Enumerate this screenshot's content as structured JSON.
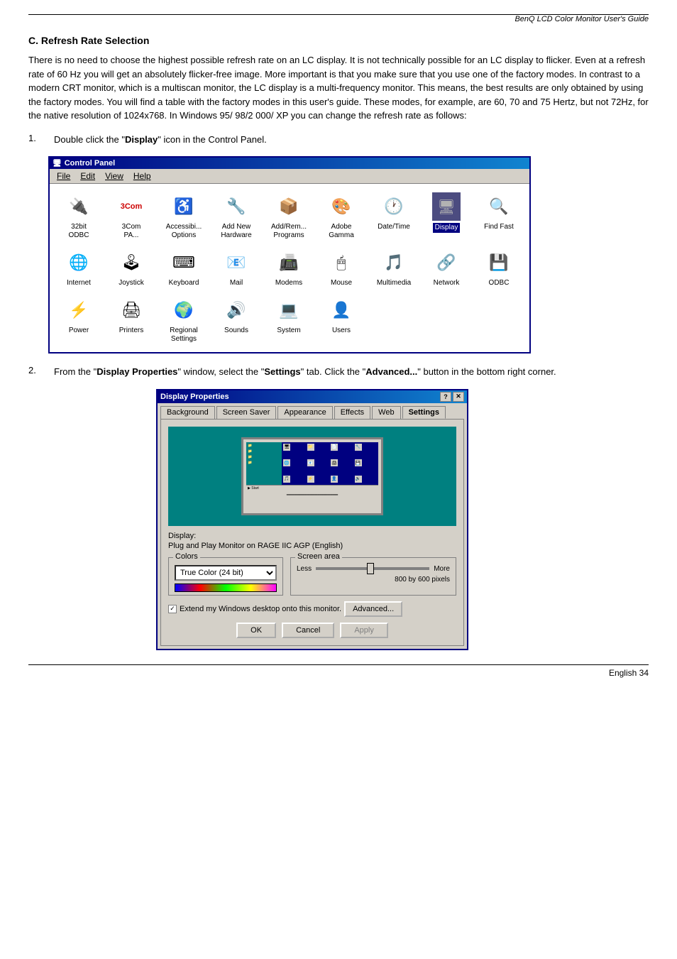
{
  "header": {
    "title": "BenQ LCD Color Monitor User's Guide"
  },
  "section": {
    "title": "C. Refresh Rate Selection",
    "body": "There is no need to choose the highest possible refresh rate on an LC display. It is not technically possible for an LC display to flicker. Even at a refresh rate of 60 Hz you will get an absolutely flicker-free image. More important is that you make sure that you use one of the factory modes.  In contrast to a modern CRT monitor, which is a multiscan monitor, the LC display is a multi-frequency monitor. This means, the best results are only obtained by using the factory modes. You will find a table with the factory modes in this user's guide. These modes, for example, are 60, 70 and 75 Hertz, but not 72Hz, for the native resolution of 1024x768. In Windows 95/ 98/2 000/ XP you can change the refresh rate as follows:"
  },
  "step1": {
    "number": "1.",
    "text_before": "Double click the \"",
    "bold": "Display",
    "text_after": "\" icon in the Control Panel."
  },
  "step2": {
    "number": "2.",
    "text_before": "From the \"",
    "bold1": "Display Properties",
    "text_mid1": "\" window, select the \"",
    "bold2": "Settings",
    "text_mid2": "\" tab. Click the \"",
    "bold3": "Advanced...",
    "text_after": "\" button in the bottom right corner."
  },
  "control_panel": {
    "title": "Control Panel",
    "menu_items": [
      "File",
      "Edit",
      "View",
      "Help"
    ],
    "icons": [
      {
        "label": "32bit\nODBC",
        "icon": "🔌",
        "id": "32bit-odbc"
      },
      {
        "label": "3Com\nPA...",
        "icon": "🖥",
        "id": "3com"
      },
      {
        "label": "Accessibi...\nOptions",
        "icon": "♿",
        "id": "accessibility"
      },
      {
        "label": "Add New\nHardware",
        "icon": "🔧",
        "id": "add-hardware"
      },
      {
        "label": "Add/Rem...\nPrograms",
        "icon": "📦",
        "id": "add-remove"
      },
      {
        "label": "Adobe\nGamma",
        "icon": "🎨",
        "id": "adobe-gamma"
      },
      {
        "label": "Date/Time",
        "icon": "🕐",
        "id": "date-time"
      },
      {
        "label": "Display",
        "icon": "🖥",
        "id": "display",
        "selected": true
      },
      {
        "label": "Find Fast",
        "icon": "🔍",
        "id": "find-fast"
      },
      {
        "label": "Internet",
        "icon": "🌐",
        "id": "internet"
      },
      {
        "label": "Joystick",
        "icon": "🕹",
        "id": "joystick"
      },
      {
        "label": "Keyboard",
        "icon": "⌨",
        "id": "keyboard"
      },
      {
        "label": "Mail",
        "icon": "📧",
        "id": "mail"
      },
      {
        "label": "Modems",
        "icon": "📠",
        "id": "modems"
      },
      {
        "label": "Mouse",
        "icon": "🖱",
        "id": "mouse"
      },
      {
        "label": "Multimedia",
        "icon": "🎵",
        "id": "multimedia"
      },
      {
        "label": "Network",
        "icon": "🔗",
        "id": "network"
      },
      {
        "label": "ODBC",
        "icon": "💾",
        "id": "odbc"
      },
      {
        "label": "Power",
        "icon": "⚡",
        "id": "power"
      },
      {
        "label": "Printers",
        "icon": "🖨",
        "id": "printers"
      },
      {
        "label": "Regional\nSettings",
        "icon": "🌍",
        "id": "regional"
      },
      {
        "label": "Sounds",
        "icon": "🔊",
        "id": "sounds"
      },
      {
        "label": "System",
        "icon": "💻",
        "id": "system"
      },
      {
        "label": "Users",
        "icon": "👤",
        "id": "users"
      }
    ]
  },
  "display_properties": {
    "title": "Display Properties",
    "tabs": [
      "Background",
      "Screen Saver",
      "Appearance",
      "Effects",
      "Web",
      "Settings"
    ],
    "active_tab": "Settings",
    "display_label": "Display:",
    "display_value": "Plug and Play Monitor on RAGE IIC AGP (English)",
    "colors_group": "Colors",
    "colors_value": "True Color (24 bit)",
    "screen_area_group": "Screen area",
    "less_label": "Less",
    "more_label": "More",
    "pixels_label": "800 by 600 pixels",
    "checkbox_label": "Extend my Windows desktop onto this monitor.",
    "advanced_btn": "Advanced...",
    "ok_btn": "OK",
    "cancel_btn": "Cancel",
    "apply_btn": "Apply"
  },
  "footer": {
    "text": "English  34"
  }
}
